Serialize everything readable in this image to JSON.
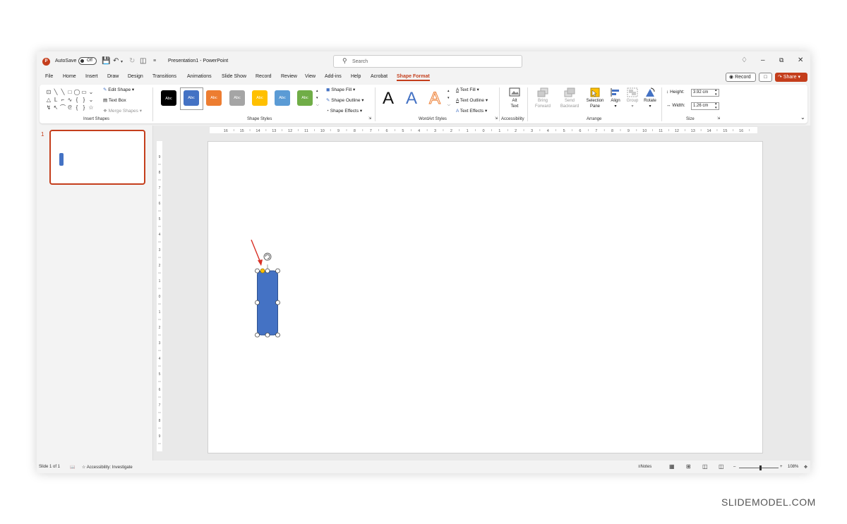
{
  "titlebar": {
    "app_logo": "P",
    "autosave_label": "AutoSave",
    "autosave_state": "Off",
    "doc_title": "Presentation1 - PowerPoint",
    "search_placeholder": "Search",
    "icons": [
      "save-icon",
      "undo-icon",
      "redo-icon",
      "present-icon",
      "customize-qa-icon",
      "diamond-icon",
      "minimize-icon",
      "restore-icon",
      "close-icon"
    ]
  },
  "menu": {
    "tabs": [
      "File",
      "Home",
      "Insert",
      "Draw",
      "Design",
      "Transitions",
      "Animations",
      "Slide Show",
      "Record",
      "Review",
      "View",
      "Add-ins",
      "Help",
      "Acrobat",
      "Shape Format"
    ],
    "active_tab": "Shape Format",
    "record_label": "Record",
    "share_label": "Share"
  },
  "ribbon": {
    "insert_shapes": {
      "label": "Insert Shapes",
      "shape_glyphs": [
        "⊡",
        "╲",
        "╲",
        "□",
        "◯",
        "▭",
        "⌄",
        "△",
        "ᒪ",
        "⌐",
        "∿",
        "{",
        "}",
        "⌄",
        "↯",
        "↖",
        "⌒",
        "ᘓ",
        "{",
        "}",
        "☆"
      ],
      "edit_shape": "Edit Shape",
      "text_box": "Text Box",
      "merge_shapes": "Merge Shapes"
    },
    "shape_styles": {
      "label": "Shape Styles",
      "swatch_text": "Abc",
      "swatch_colors": [
        "#000000",
        "#4472c4",
        "#ed7d31",
        "#a5a5a5",
        "#ffc000",
        "#5b9bd5",
        "#70ad47"
      ],
      "shape_fill": "Shape Fill",
      "shape_outline": "Shape Outline",
      "shape_effects": "Shape Effects"
    },
    "wordart": {
      "label": "WordArt Styles",
      "letters": [
        "A",
        "A",
        "A"
      ],
      "text_fill": "Text Fill",
      "text_outline": "Text Outline",
      "text_effects": "Text Effects"
    },
    "accessibility": {
      "label": "Accessibility",
      "alt_text_1": "Alt",
      "alt_text_2": "Text"
    },
    "arrange": {
      "label": "Arrange",
      "bring_forward_1": "Bring",
      "bring_forward_2": "Forward",
      "send_backward_1": "Send",
      "send_backward_2": "Backward",
      "selection_pane_1": "Selection",
      "selection_pane_2": "Pane",
      "align": "Align",
      "group": "Group",
      "rotate": "Rotate"
    },
    "size": {
      "label": "Size",
      "height_label": "Height:",
      "height_value": "3.92 cm",
      "width_label": "Width:",
      "width_value": "1.26 cm"
    }
  },
  "slides_pane": {
    "slide_number": "1"
  },
  "rulers": {
    "horizontal_ticks": [
      "16",
      "15",
      "14",
      "13",
      "12",
      "11",
      "10",
      "9",
      "8",
      "7",
      "6",
      "5",
      "4",
      "3",
      "2",
      "1",
      "0",
      "1",
      "2",
      "3",
      "4",
      "5",
      "6",
      "7",
      "8",
      "9",
      "10",
      "11",
      "12",
      "13",
      "14",
      "15",
      "16"
    ],
    "vertical_ticks": [
      "9",
      "8",
      "7",
      "6",
      "5",
      "4",
      "3",
      "2",
      "1",
      "0",
      "1",
      "2",
      "3",
      "4",
      "5",
      "6",
      "7",
      "8",
      "9"
    ]
  },
  "canvas": {
    "shape_fill_color": "#4472c4",
    "shape_stroke_color": "#2f528f",
    "handle_color": "#ffffff",
    "adjust_handle_color": "#ffc000",
    "arrow_color": "#d93025"
  },
  "statusbar": {
    "slide_info": "Slide 1 of 1",
    "accessibility": "Accessibility: Investigate",
    "notes": "Notes",
    "zoom": "108%"
  },
  "watermark": "SLIDEMODEL.COM"
}
